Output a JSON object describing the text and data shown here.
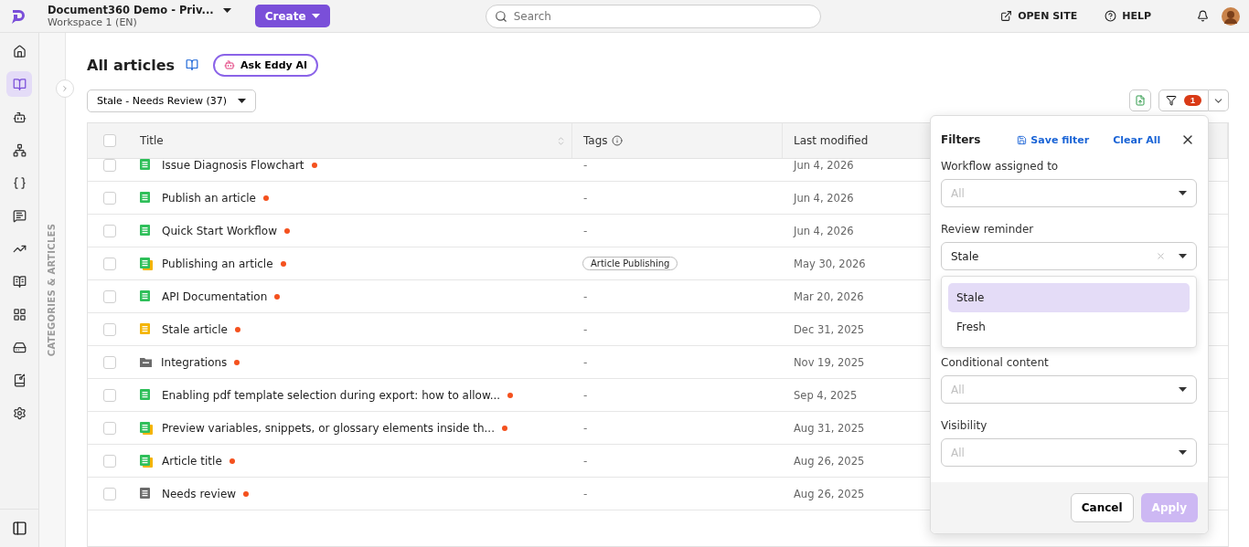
{
  "app": {
    "workspace_name": "Document360 Demo - Priv...",
    "workspace": "Workspace 1 (EN)",
    "create_button": "Create"
  },
  "search": {
    "placeholder": "Search"
  },
  "header_links": [
    "OPEN SITE",
    "HELP"
  ],
  "rail": {
    "items": [
      {
        "selected": false
      },
      {
        "selected": true
      },
      {
        "selected": false
      },
      {
        "selected": false
      },
      {
        "selected": false
      },
      {
        "selected": false
      },
      {
        "selected": false
      },
      {
        "selected": false
      },
      {
        "selected": false
      },
      {
        "selected": false
      },
      {
        "selected": false
      },
      {
        "selected": false
      }
    ]
  },
  "side_panel": {
    "label": "CATEGORIES & ARTICLES"
  },
  "page": {
    "title": "All articles",
    "ask_button": "Ask Eddy AI",
    "view_select": "Stale - Needs Review (37)",
    "filter_count": "1"
  },
  "table": {
    "header_checked": false,
    "columns": [
      "Title",
      "Tags",
      "Last modified"
    ],
    "rows": [
      {
        "checked": false,
        "kind": "article",
        "title": "Issue Diagnosis Flowchart",
        "tag": "-",
        "modified": "Jun 4, 2026"
      },
      {
        "checked": false,
        "kind": "article",
        "title": "Publish an article",
        "tag": "-",
        "modified": "Jun 4, 2026"
      },
      {
        "checked": false,
        "kind": "article",
        "title": "Quick Start Workflow",
        "tag": "-",
        "modified": "Jun 4, 2026"
      },
      {
        "checked": false,
        "kind": "draft",
        "title": "Publishing an article",
        "tag": "Article Publishing",
        "modified": "May 30, 2026"
      },
      {
        "checked": false,
        "kind": "article",
        "title": "API Documentation",
        "tag": "-",
        "modified": "Mar 20, 2026"
      },
      {
        "checked": false,
        "kind": "stale",
        "title": "Stale article",
        "tag": "-",
        "modified": "Dec 31, 2025"
      },
      {
        "checked": false,
        "kind": "folder",
        "title": "Integrations",
        "tag": "-",
        "modified": "Nov 19, 2025"
      },
      {
        "checked": false,
        "kind": "article",
        "title": "Enabling pdf template selection during export: how to allow...",
        "tag": "-",
        "modified": "Sep 4, 2025"
      },
      {
        "checked": false,
        "kind": "draft",
        "title": "Preview variables, snippets, or glossary elements inside th...",
        "tag": "-",
        "modified": "Aug 31, 2025"
      },
      {
        "checked": false,
        "kind": "draft",
        "title": "Article title",
        "tag": "-",
        "modified": "Aug 26, 2025"
      },
      {
        "checked": false,
        "kind": "review",
        "title": "Needs review",
        "tag": "-",
        "modified": "Aug 26, 2025"
      }
    ]
  },
  "filters": {
    "title": "Filters",
    "save": "Save filter",
    "clear": "Clear All",
    "fields": [
      {
        "label": "Workflow assigned to",
        "placeholder": "All"
      },
      {
        "label": "Review reminder",
        "value": "Stale",
        "expanded": true,
        "options": [
          {
            "label": "Stale",
            "selected": true
          },
          {
            "label": "Fresh",
            "selected": false
          }
        ]
      },
      {
        "label": "Conditional content",
        "placeholder": "All"
      },
      {
        "label": "Visibility",
        "placeholder": "All"
      }
    ],
    "cancel": "Cancel",
    "apply": {
      "label": "Apply",
      "disabled": true
    }
  }
}
